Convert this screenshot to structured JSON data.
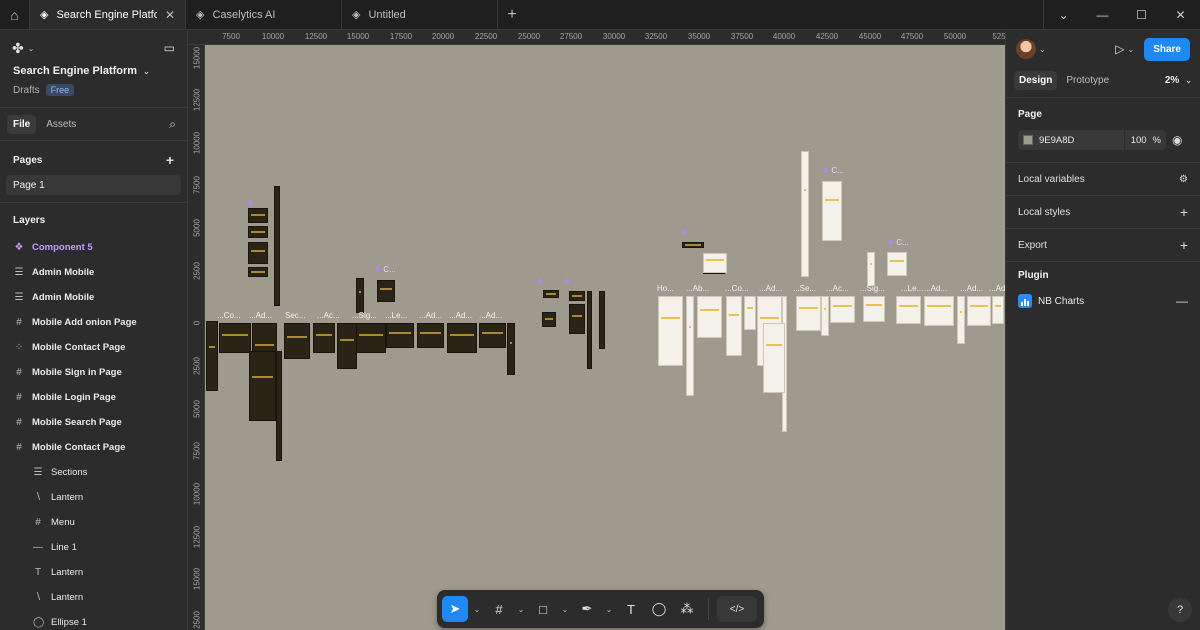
{
  "tabs": [
    {
      "label": "Search Engine Platform",
      "icon": "figma-file-icon",
      "active": true
    },
    {
      "label": "Caselytics AI",
      "icon": "figma-file-icon",
      "active": false
    },
    {
      "label": "Untitled",
      "icon": "figma-file-icon",
      "active": false
    }
  ],
  "project": {
    "name": "Search Engine Platform",
    "location": "Drafts",
    "plan": "Free"
  },
  "left_tabs": {
    "file": "File",
    "assets": "Assets"
  },
  "pages": {
    "heading": "Pages",
    "items": [
      "Page 1"
    ]
  },
  "layers": {
    "heading": "Layers",
    "items": [
      {
        "label": "Component 5",
        "icon": "component-icon"
      },
      {
        "label": "Admin Mobile",
        "icon": "section-icon"
      },
      {
        "label": "Admin Mobile",
        "icon": "section-icon"
      },
      {
        "label": "Mobile Add onion Page",
        "icon": "frame-icon"
      },
      {
        "label": "Mobile Contact Page",
        "icon": "group-icon"
      },
      {
        "label": "Mobile Sign in Page",
        "icon": "frame-icon"
      },
      {
        "label": "Mobile Login Page",
        "icon": "frame-icon"
      },
      {
        "label": "Mobile Search Page",
        "icon": "frame-icon"
      },
      {
        "label": "Mobile Contact Page",
        "icon": "frame-icon"
      },
      {
        "label": "Sections",
        "icon": "section-icon"
      },
      {
        "label": "Lantern",
        "icon": "vector-icon"
      },
      {
        "label": "Menu",
        "icon": "frame-icon"
      },
      {
        "label": "Line 1",
        "icon": "line-icon"
      },
      {
        "label": "Lantern",
        "icon": "text-icon"
      },
      {
        "label": "Lantern",
        "icon": "vector-icon"
      },
      {
        "label": "Ellipse 1",
        "icon": "ellipse-icon"
      }
    ]
  },
  "ruler_top": [
    "7500",
    "10000",
    "12500",
    "15000",
    "17500",
    "20000",
    "22500",
    "25000",
    "27500",
    "30000",
    "32500",
    "35000",
    "37500",
    "40000",
    "42500",
    "45000",
    "47500",
    "50000",
    "525"
  ],
  "ruler_left": [
    "15000",
    "12500",
    "10000",
    "7500",
    "5000",
    "2500",
    "0",
    "2500",
    "5000",
    "7500",
    "10000",
    "12500",
    "15000",
    "2500"
  ],
  "frame_labels": [
    "...Co...",
    "...Ad...",
    "Sec...",
    "...Ac...",
    "...Sig...",
    "...Le...",
    "...Ad...",
    "...Ad...",
    "...Ad...",
    "Ho...",
    "...Ab...",
    "...Co...",
    "...Ad...",
    "...Se...",
    "...Ac...",
    "...Sig...",
    "...Le...",
    "...Ad...",
    "...Ad...",
    "...Ad..."
  ],
  "component_labels": [
    "C...",
    "C...",
    "C..."
  ],
  "toolbar": {
    "tools": [
      {
        "name": "move-tool",
        "glyph": "➤",
        "caret": true,
        "active": true
      },
      {
        "name": "frame-tool",
        "glyph": "#",
        "caret": true,
        "active": false
      },
      {
        "name": "rectangle-tool",
        "glyph": "□",
        "caret": true,
        "active": false
      },
      {
        "name": "pen-tool",
        "glyph": "✒",
        "caret": true,
        "active": false
      },
      {
        "name": "text-tool",
        "glyph": "T",
        "caret": false,
        "active": false
      },
      {
        "name": "comment-tool",
        "glyph": "◯",
        "caret": false,
        "active": false
      },
      {
        "name": "actions-tool",
        "glyph": "⁂",
        "caret": false,
        "active": false
      }
    ],
    "code": "</>"
  },
  "right": {
    "share": "Share",
    "tabs": {
      "design": "Design",
      "prototype": "Prototype"
    },
    "zoom": "2%",
    "page_heading": "Page",
    "bg_hex": "9E9A8D",
    "bg_opacity": "100",
    "percent": "%",
    "local_variables": "Local variables",
    "local_styles": "Local styles",
    "export": "Export",
    "plugin_heading": "Plugin",
    "plugin_name": "NB Charts"
  },
  "help": "?",
  "colors": {
    "canvas": "#9E9A8D",
    "accent": "#1E88F5",
    "component": "#C79BFF"
  }
}
